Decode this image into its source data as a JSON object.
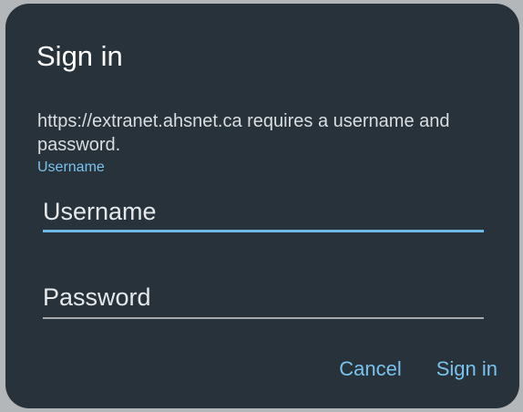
{
  "dialog": {
    "title": "Sign in",
    "message": "https://extranet.ahsnet.ca requires a username and password."
  },
  "username": {
    "floating_label": "Username",
    "placeholder": "Username",
    "value": ""
  },
  "password": {
    "placeholder": "Password",
    "value": ""
  },
  "actions": {
    "cancel_label": "Cancel",
    "signin_label": "Sign in"
  },
  "colors": {
    "dialog_background": "#27323a",
    "accent": "#7ac2ee",
    "text_primary": "#ffffff",
    "text_secondary": "#d9dde0"
  }
}
